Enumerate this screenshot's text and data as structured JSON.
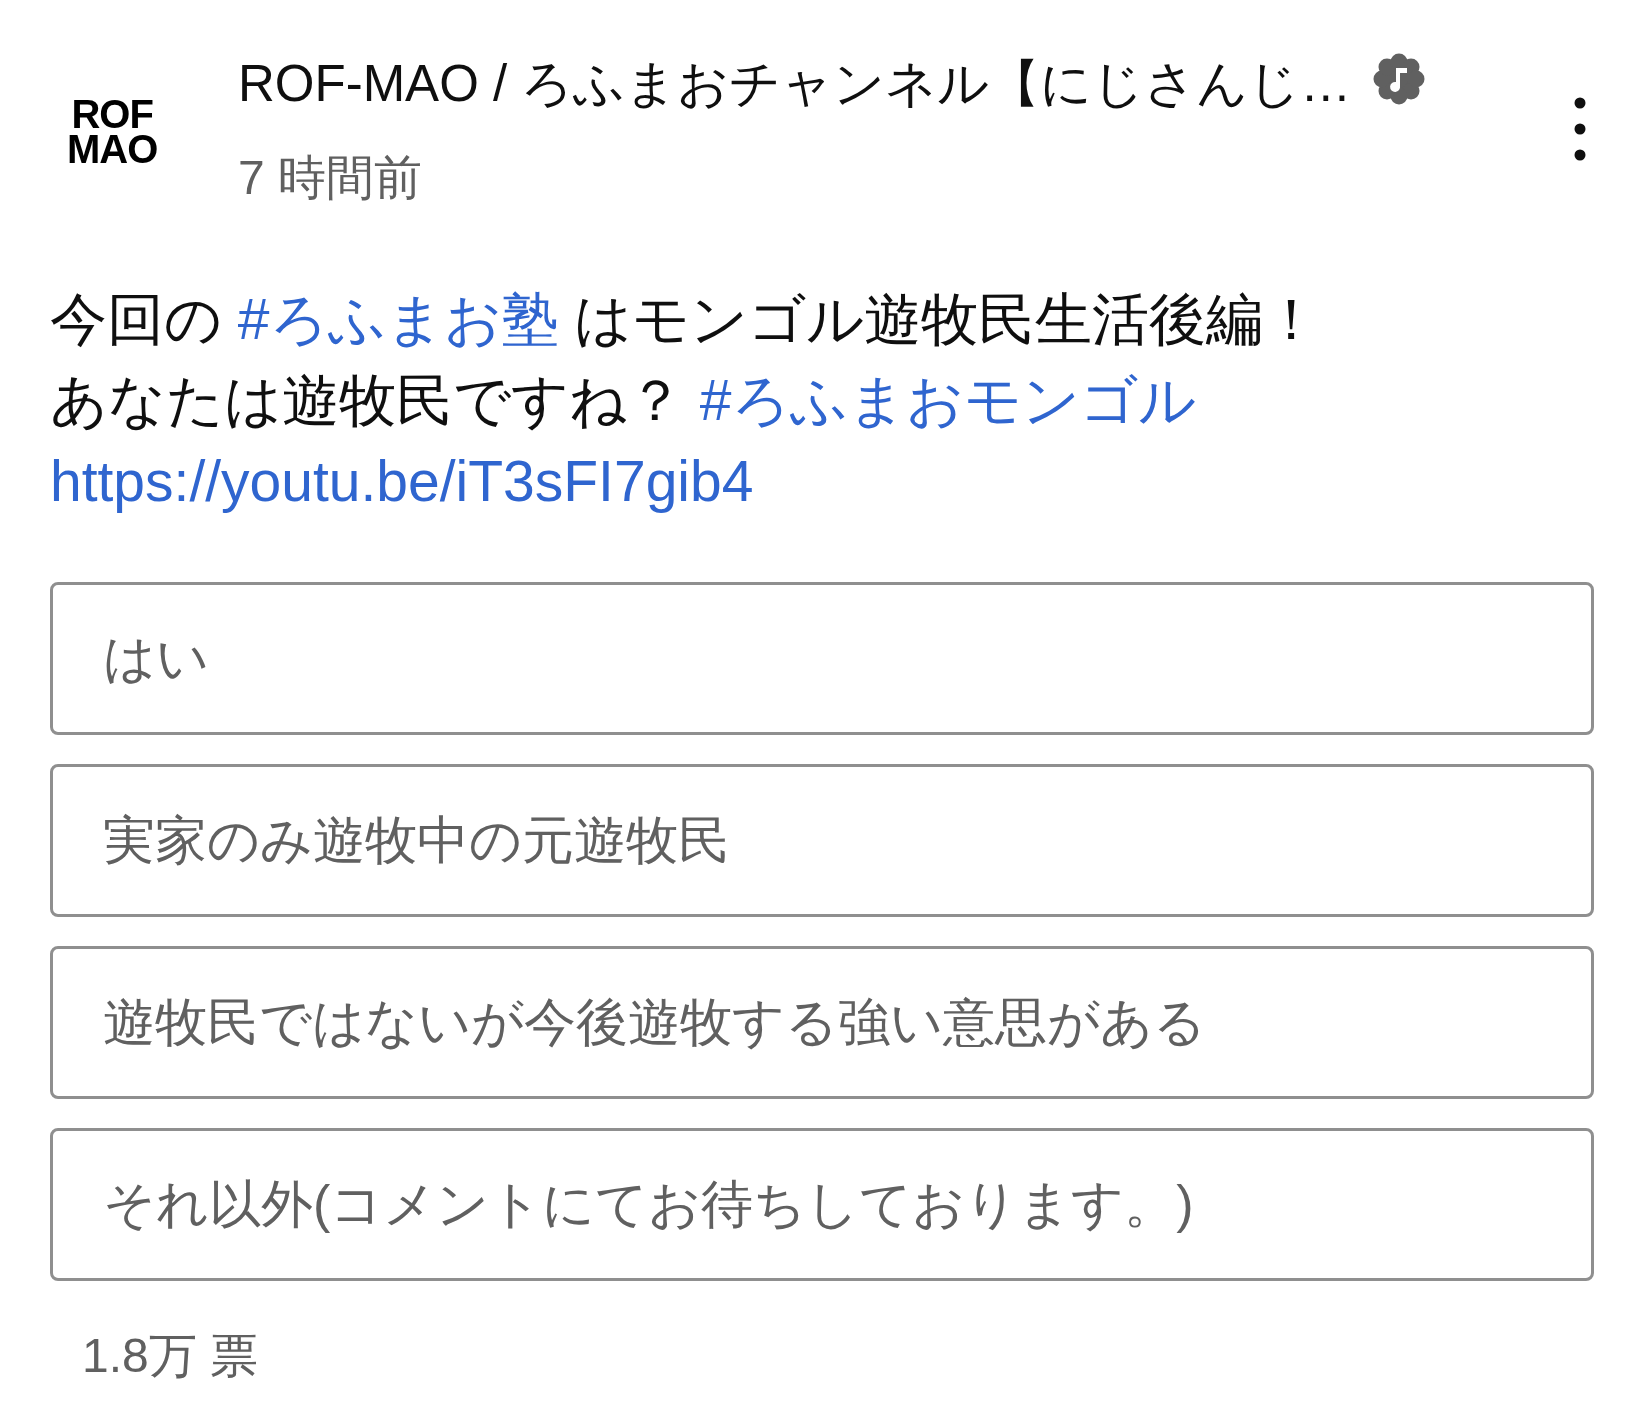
{
  "post": {
    "logo_text": "ROF MAO",
    "channel_name": "ROF-MAO / ろふまおチャンネル【にじさんじ…",
    "time": "7 時間前"
  },
  "body": {
    "lines": [
      [
        {
          "kind": "text",
          "text": "今回の "
        },
        {
          "kind": "link",
          "text": "#ろふまお塾"
        },
        {
          "kind": "text",
          "text": " はモンゴル遊牧民生活後編！"
        }
      ],
      [
        {
          "kind": "text",
          "text": "あなたは遊牧民ですね？ "
        },
        {
          "kind": "link",
          "text": "#ろふまおモンゴル"
        }
      ],
      [
        {
          "kind": "link",
          "text": "https://youtu.be/iT3sFI7gib4"
        }
      ]
    ]
  },
  "poll": {
    "options": [
      {
        "text": "はい"
      },
      {
        "text": "実家のみ遊牧中の元遊牧民"
      },
      {
        "text": "遊牧民ではないが今後遊牧する強い意思がある"
      },
      {
        "text": "それ以外(コメントにてお待ちしております。)"
      }
    ],
    "votes": "1.8万 票"
  }
}
